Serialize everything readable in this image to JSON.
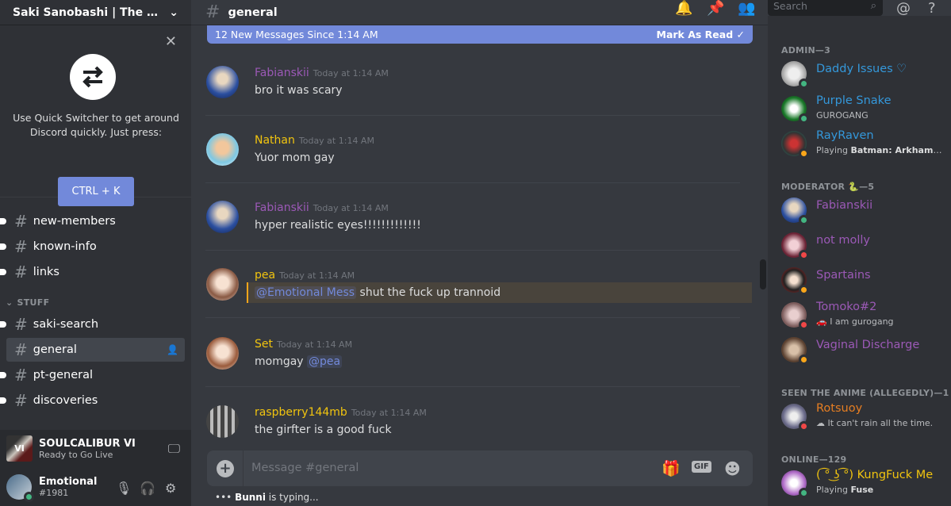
{
  "server": {
    "name": "Saki Sanobashi | The Lost..."
  },
  "quick_switcher": {
    "text": "Use Quick Switcher to get around Discord quickly. Just press:",
    "button": "CTRL + K"
  },
  "channels": [
    {
      "name": "new-members",
      "unread": true,
      "selected": false
    },
    {
      "name": "known-info",
      "unread": true,
      "selected": false
    },
    {
      "name": "links",
      "unread": true,
      "selected": false
    }
  ],
  "category": "STUFF",
  "channels2": [
    {
      "name": "saki-search",
      "unread": true
    },
    {
      "name": "general",
      "selected": true
    },
    {
      "name": "pt-general",
      "unread": true
    },
    {
      "name": "discoveries",
      "unread": true
    }
  ],
  "game": {
    "title": "SOULCALIBUR VI",
    "subtitle": "Ready to Go Live",
    "icon_text": "VI"
  },
  "user": {
    "name": "Emotional ...",
    "tag": "#1981"
  },
  "chat": {
    "channel": "general",
    "new_messages": "12 New Messages Since 1:14 AM",
    "mark_read": "Mark As Read",
    "input_placeholder": "Message #general",
    "gif_label": "GIF",
    "typing_user": "Bunni",
    "typing_suffix": "is typing...",
    "messages": [
      {
        "author": "Fabianskii",
        "color": "#9b59b6",
        "time": "Today at 1:14 AM",
        "text": "bro it was scary"
      },
      {
        "author": "Nathan",
        "color": "#f1c40f",
        "time": "Today at 1:14 AM",
        "text": "Yuor mom gay"
      },
      {
        "author": "Fabianskii",
        "color": "#9b59b6",
        "time": "Today at 1:14 AM",
        "text": "hyper realistic eyes!!!!!!!!!!!!!"
      },
      {
        "author": "pea",
        "color": "#f1c40f",
        "time": "Today at 1:14 AM",
        "mention": "@Emotional Mess",
        "text": " shut the fuck up trannoid"
      },
      {
        "author": "Set",
        "color": "#f1c40f",
        "time": "Today at 1:14 AM",
        "text": "momgay ",
        "mention": "@pea"
      },
      {
        "author": "raspberry144mb",
        "color": "#f1c40f",
        "time": "Today at 1:14 AM",
        "text": "the girfter is a good fuck"
      }
    ]
  },
  "search": {
    "placeholder": "Search"
  },
  "members": {
    "roles": [
      "ADMIN—3",
      "MODERATOR 🐍—5",
      "SEEN THE ANIME (ALLEGEDLY)—1",
      "ONLINE—129"
    ],
    "list": [
      {
        "name": "Daddy Issues ♡",
        "color": "#3498db",
        "status": "on"
      },
      {
        "name": "Purple Snake",
        "color": "#3498db",
        "sub": "GUROGANG",
        "status": "on"
      },
      {
        "name": "RayRaven",
        "color": "#3498db",
        "sub_pre": "Playing ",
        "sub_bold": "Batman: Arkham City ...",
        "status": "idle"
      },
      {
        "name": "Fabianskii",
        "color": "#9b59b6",
        "status": "on"
      },
      {
        "name": "not molly",
        "color": "#9b59b6",
        "status": "dnd"
      },
      {
        "name": "Spartains",
        "color": "#9b59b6",
        "status": "idle"
      },
      {
        "name": "Tomoko#2",
        "color": "#9b59b6",
        "sub": "🚗 I am gurogang",
        "status": "dnd"
      },
      {
        "name": "Vaginal Discharge",
        "color": "#9b59b6",
        "status": "idle"
      },
      {
        "name": "Rotsuoy",
        "color": "#e67e22",
        "sub": "☁ It can't rain all the time.",
        "status": "dnd"
      },
      {
        "name": "( ͡° ͜ʖ ͡°) KungFuck Me",
        "color": "#f1c40f",
        "sub_pre": "Playing ",
        "sub_bold": "Fuse",
        "status": "on"
      }
    ]
  }
}
